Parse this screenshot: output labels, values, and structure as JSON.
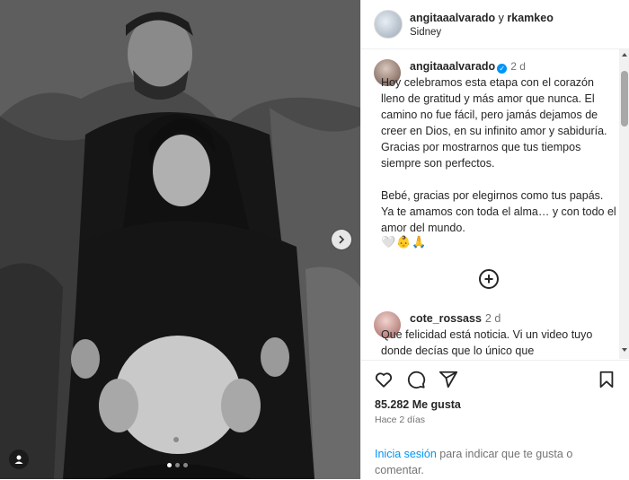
{
  "header": {
    "user1": "angitaaalvarado",
    "conjunction": "y",
    "user2": "rkamkeo",
    "location": "Sidney"
  },
  "caption": {
    "username": "angitaaalvarado",
    "verified": true,
    "time": "2 d",
    "paragraph1": "Hoy celebramos esta etapa con el corazón lleno de gratitud y más amor que nunca. El camino no fue fácil, pero jamás dejamos de creer en Dios, en su infinito amor y sabiduría. Gracias por mostrarnos que tus tiempos siempre son perfectos.",
    "paragraph2": "Bebé, gracias por elegirnos como tus papás. Ya te amamos con toda el alma… y con todo el amor del mundo.",
    "emojis": "🤍👶🙏"
  },
  "load_more": "+",
  "comment": {
    "username": "cote_rossass",
    "time": "2 d",
    "text": "Que felicidad está noticia. Vi un video tuyo donde decías que lo único que"
  },
  "actions": {
    "likes": "85.282 Me gusta",
    "posted": "Hace 2 días",
    "login_link": "Inicia sesión",
    "login_rest": " para indicar que te gusta o comentar."
  },
  "carousel": {
    "total": 3,
    "active": 0
  },
  "icons": {
    "like": "heart-icon",
    "comment": "comment-icon",
    "share": "send-icon",
    "save": "bookmark-icon",
    "next": "chevron-right-icon",
    "tags": "person-tag-icon",
    "more": "plus-circle-icon"
  },
  "colors": {
    "link": "#0095f6",
    "verified": "#0095f6",
    "muted": "#737373"
  }
}
